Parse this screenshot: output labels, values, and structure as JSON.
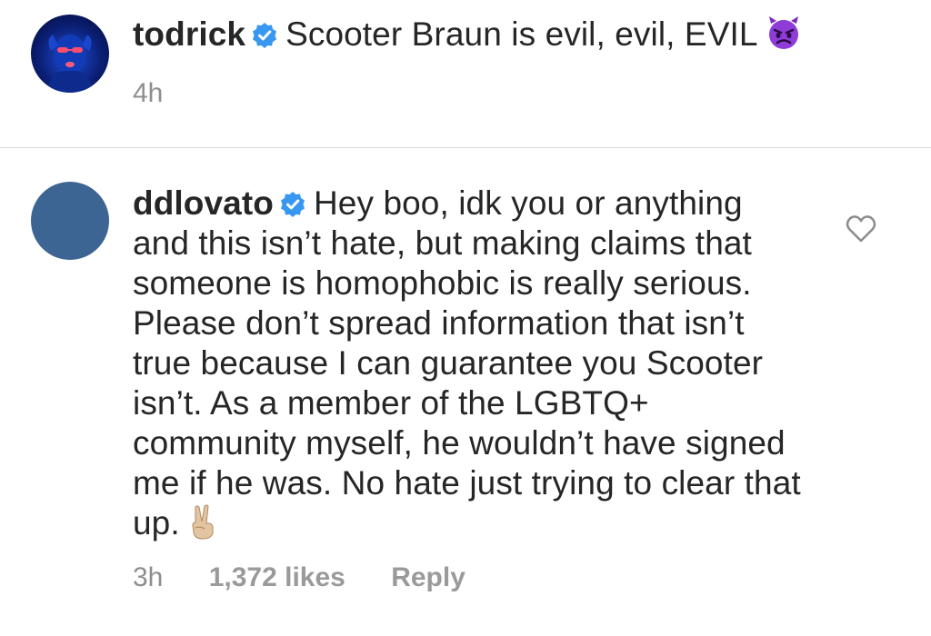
{
  "comments": [
    {
      "username": "todrick",
      "text": "Scooter Braun is evil, evil, EVIL",
      "emoji": "angry-devil-emoji",
      "time": "4h"
    },
    {
      "username": "ddlovato",
      "text": "Hey boo, idk you or anything and this isn’t hate, but making claims that someone is homophobic is really serious. Please don’t spread information that isn’t true because I can guarantee you Scooter isn’t. As a member of the LGBTQ+ community myself, he wouldn’t have signed me if he was. No hate just trying to clear that up.",
      "emoji": "victory-hand-emoji",
      "time": "3h",
      "likes": "1,372 likes",
      "reply_label": "Reply"
    }
  ],
  "colors": {
    "text": "#262626",
    "meta": "#8e8e8e",
    "verified": "#3897f0",
    "divider": "#dbdbdb"
  }
}
